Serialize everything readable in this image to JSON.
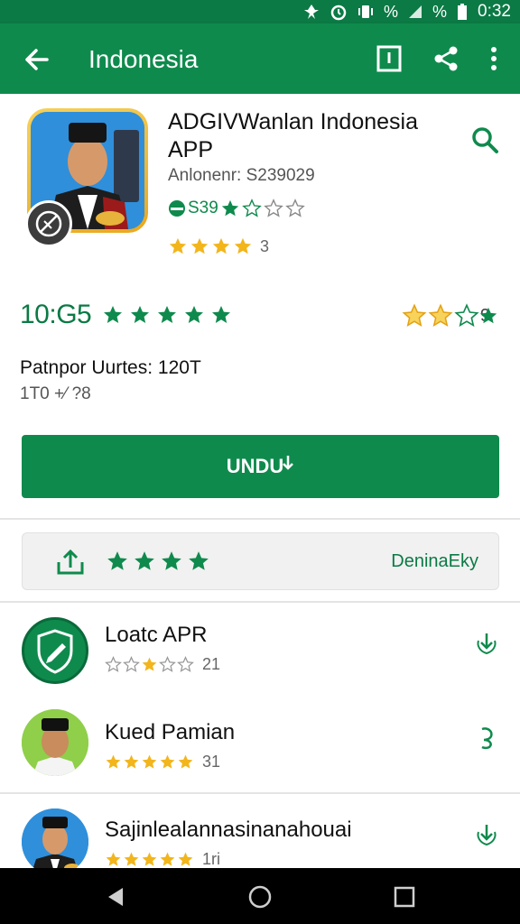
{
  "status_bar": {
    "time": "0:32",
    "pct1": "%",
    "pct2": "%"
  },
  "toolbar": {
    "title": "Indonesia"
  },
  "app": {
    "name": "ADGIVWanlan Indonesia APP",
    "developer": "Anlonenr: S239029",
    "rating_text": "S39",
    "rating_count": "3"
  },
  "stats": {
    "big_number": "10:G5",
    "right_count": "9"
  },
  "update": {
    "line": "Patnpor Uurtes: 120T",
    "sub": "1T0 +⁄ ?8"
  },
  "install": {
    "label": "UNDU"
  },
  "review_bar": {
    "label": "DeninaEky"
  },
  "related": [
    {
      "title": "Loatc APR",
      "count": "21"
    },
    {
      "title": "Kued Pamian",
      "count": "31"
    },
    {
      "title": "Sajinlealannasinanahouai",
      "count": "1ri"
    }
  ],
  "colors": {
    "primary": "#0f8a4d",
    "status": "#0b7a45",
    "star_gold": "#f2b51b",
    "star_green": "#0f8a4d"
  }
}
